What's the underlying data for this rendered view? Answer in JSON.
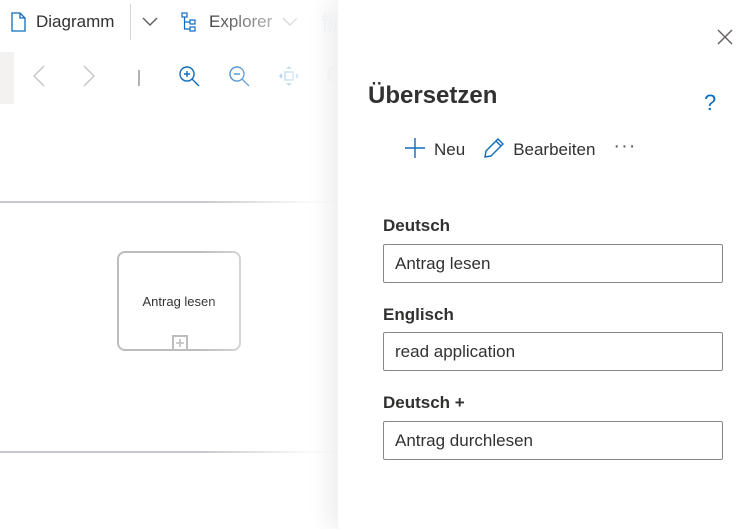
{
  "toolbar": {
    "diagram_label": "Diagramm",
    "explorer_label": "Explorer"
  },
  "canvas": {
    "task_label": "Antrag lesen"
  },
  "panel": {
    "title": "Übersetzen",
    "help_label": "?",
    "commands": {
      "new_label": "Neu",
      "edit_label": "Bearbeiten",
      "more_label": "···"
    },
    "fields": [
      {
        "label": "Deutsch",
        "value": "Antrag lesen"
      },
      {
        "label": "Englisch",
        "value": "read application"
      },
      {
        "label": "Deutsch +",
        "value": "Antrag durchlesen"
      }
    ]
  },
  "colors": {
    "accent": "#0f6cbd",
    "text": "#323130",
    "border": "#8a8886"
  }
}
